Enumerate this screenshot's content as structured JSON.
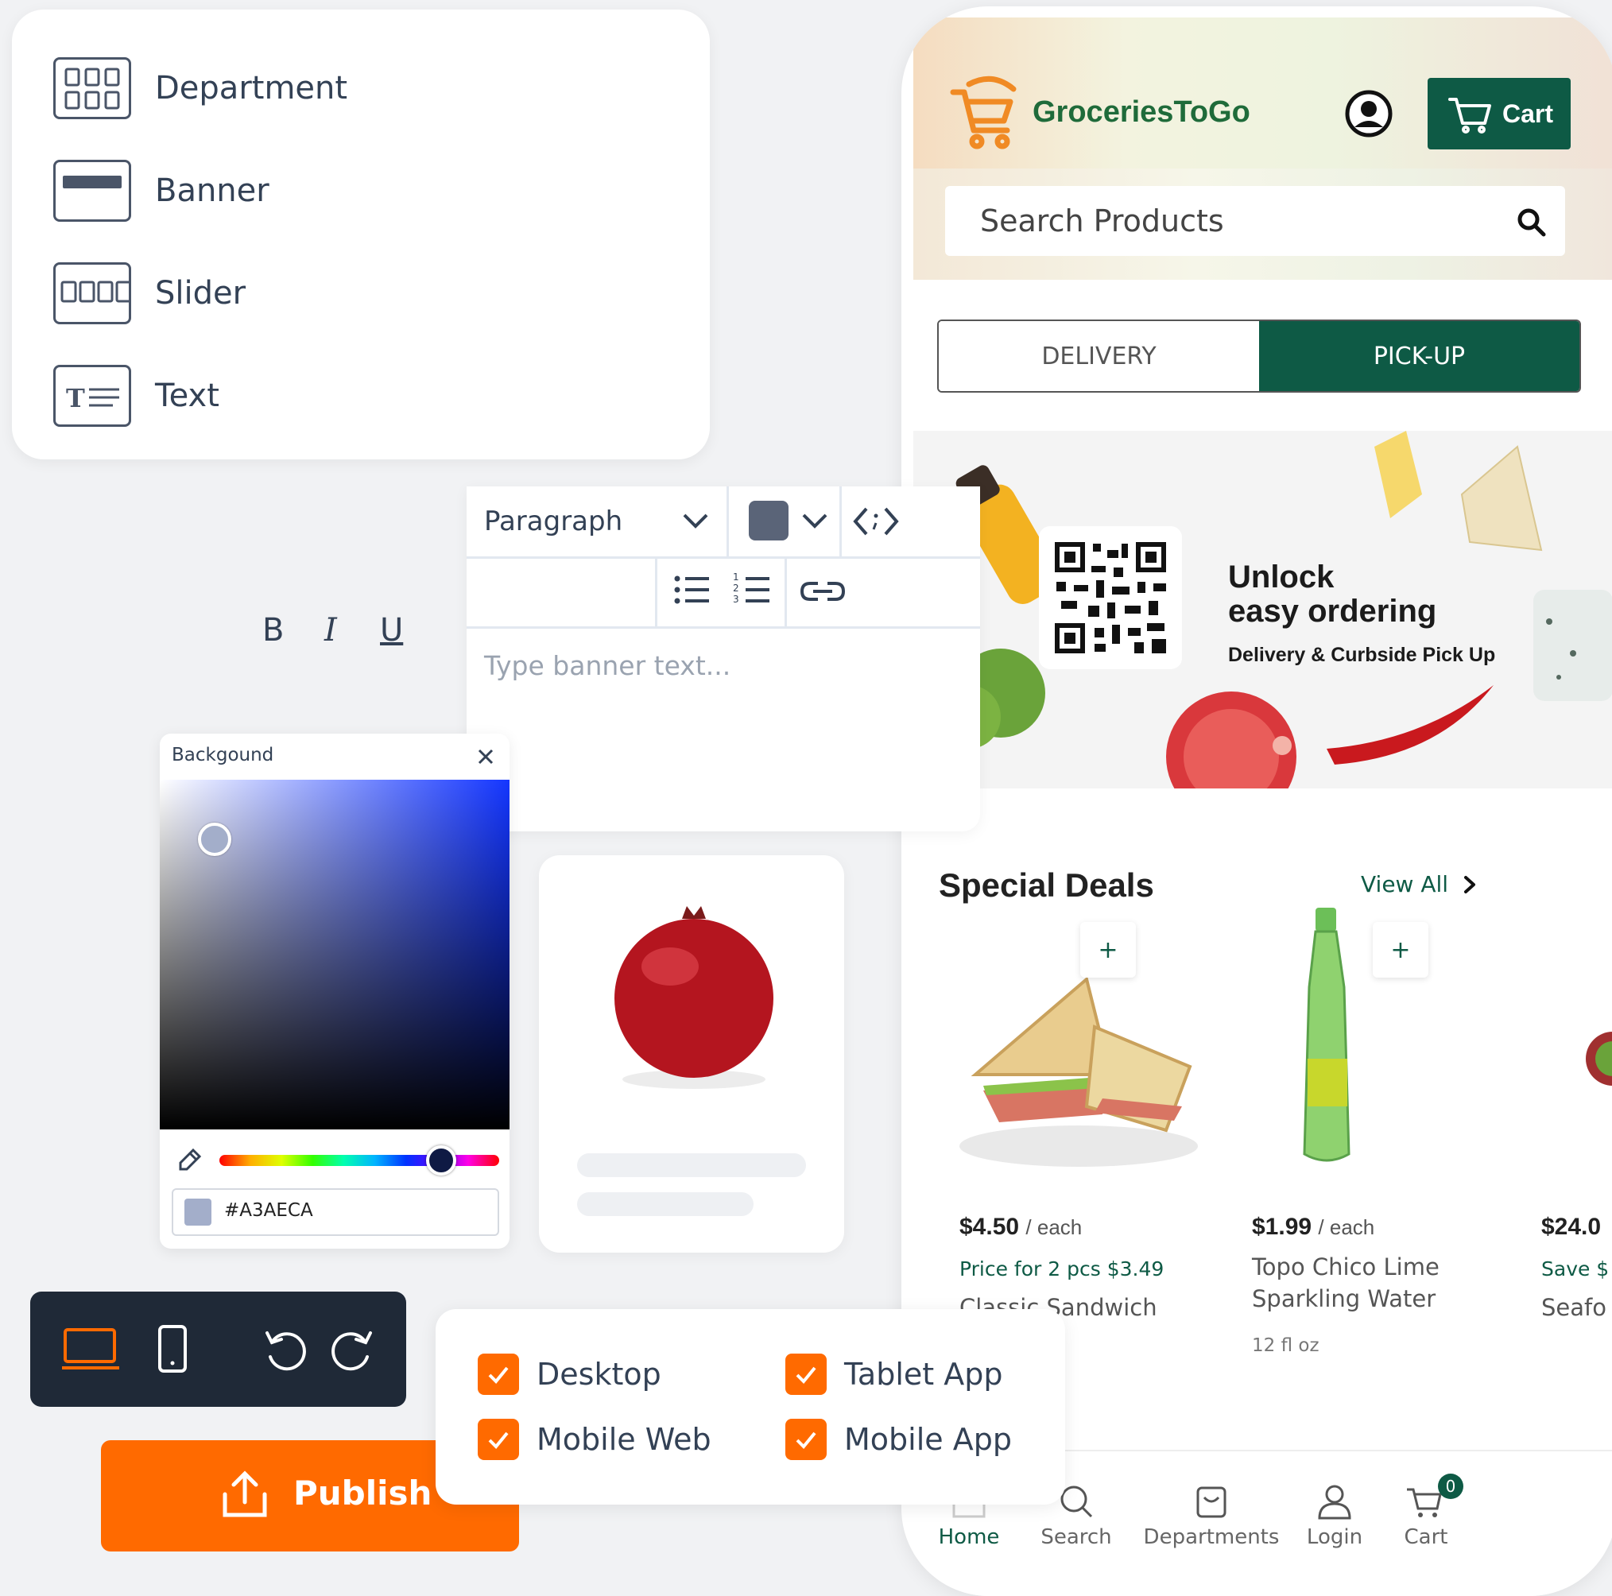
{
  "palette": {
    "items": [
      {
        "label": "Department",
        "icon": "grid-icon"
      },
      {
        "label": "Banner",
        "icon": "banner-icon"
      },
      {
        "label": "Slider",
        "icon": "slider-icon"
      },
      {
        "label": "Text",
        "icon": "text-icon"
      }
    ]
  },
  "editor": {
    "block_format": "Paragraph",
    "text_color": "#5a6478",
    "placeholder": "Type banner text...",
    "format_buttons": [
      "B",
      "I",
      "U"
    ]
  },
  "color_picker": {
    "title": "Backgound",
    "hex_value": "#A3AECA",
    "selected_color": "#A3AECA",
    "hue_color": "#0f1a44"
  },
  "device_toolbar": {
    "active_device": "desktop",
    "accent": "#ff6a00"
  },
  "publish": {
    "label": "Publish",
    "color": "#ff6a00"
  },
  "targets": [
    {
      "label": "Desktop",
      "checked": true
    },
    {
      "label": "Tablet App",
      "checked": true
    },
    {
      "label": "Mobile Web",
      "checked": true
    },
    {
      "label": "Mobile App",
      "checked": true
    }
  ],
  "app": {
    "brand": "GroceriesToGo",
    "cart_label": "Cart",
    "search_placeholder": "Search Products",
    "tabs": [
      {
        "label": "DELIVERY",
        "active": false
      },
      {
        "label": "PICK-UP",
        "active": true
      }
    ],
    "banner": {
      "heading_line1": "Unlock",
      "heading_line2": "easy ordering",
      "subheading": "Delivery & Curbside Pick Up"
    },
    "deals": {
      "title": "Special Deals",
      "view_all": "View All",
      "products": [
        {
          "price": "$4.50",
          "unit": "/ each",
          "promo": "Price for 2 pcs $3.49",
          "name": "Classic Sandwich",
          "size": ""
        },
        {
          "price": "$1.99",
          "unit": "/ each",
          "promo": "",
          "name": "Topo Chico Lime Sparkling Water",
          "size": "12 fl oz"
        },
        {
          "price": "$24.0",
          "unit": "",
          "promo": "Save $",
          "name": "Seafo",
          "size": ""
        }
      ]
    },
    "bottom_nav": [
      {
        "label": "Home",
        "icon": "home-icon"
      },
      {
        "label": "Search",
        "icon": "search-icon"
      },
      {
        "label": "Departments",
        "icon": "bag-icon"
      },
      {
        "label": "Login",
        "icon": "user-icon"
      },
      {
        "label": "Cart",
        "icon": "cart-icon",
        "badge": "0"
      }
    ],
    "brand_color": "#0e5a45"
  }
}
